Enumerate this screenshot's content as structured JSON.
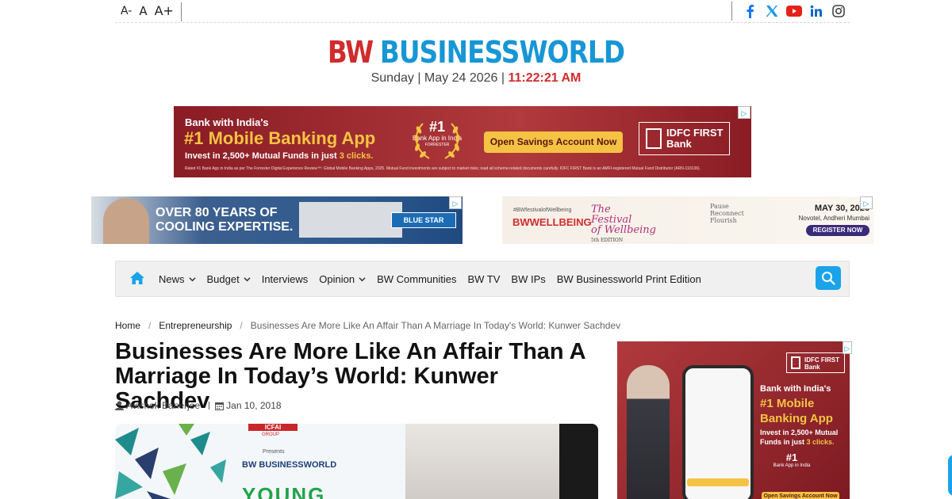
{
  "font_controls": {
    "decrease": "A-",
    "normal": "A",
    "increase": "A+"
  },
  "social_icons": [
    "facebook-icon",
    "x-icon",
    "youtube-icon",
    "linkedin-icon",
    "instagram-icon"
  ],
  "colors": {
    "brand_red": "#d12c2c",
    "brand_blue": "#1796d5",
    "search_button": "#1aa3e8",
    "ad_maroon": "#8a1c25",
    "ad_yellow": "#f5c343"
  },
  "logo": {
    "bw": "BW",
    "name": "BUSINESSWORLD"
  },
  "dateline": {
    "date": "Sunday | May 24 2026 |",
    "time": "11:22:21 AM"
  },
  "ads": {
    "top_banner": {
      "line1": "Bank with India's",
      "line2": "#1 Mobile Banking App",
      "line3_prefix": "Invest in 2,500+ Mutual Funds in just",
      "line3_highlight": "3 clicks.",
      "badge_number": "#1",
      "badge_text": "Bank App in India",
      "badge_source": "FORRESTER",
      "cta": "Open Savings Account Now",
      "bank_name_1": "IDFC FIRST",
      "bank_name_2": "Bank",
      "disclaimer": "Rated #1 Bank App in India as per The Forrester Digital Experience Review™: Global Mobile Banking Apps, 2025. Mutual Fund investments are subject to market risks; read all scheme-related documents carefully. IDFC FIRST Bank is an AMFI-registered Mutual Fund Distributor (ARN-110136)."
    },
    "left_banner": {
      "line1": "OVER 80 YEARS OF",
      "line2": "COOLING EXPERTISE.",
      "brand": "BLUE STAR"
    },
    "right_banner": {
      "hashtag": "#BWfestivalofWellbeing",
      "bw_wellbeing": "BWWELLBEING",
      "festival_1": "The",
      "festival_2": "Festival",
      "festival_3": "of Wellbeing",
      "edition": "5th EDITION",
      "tagline_1": "Pause",
      "tagline_2": "Reconnect",
      "tagline_3": "Flourish",
      "date": "MAY 30, 2026",
      "venue": "Novotel, Andheri Mumbai",
      "cta": "REGISTER NOW"
    },
    "side_banner": {
      "bank_name_1": "IDFC FIRST",
      "bank_name_2": "Bank",
      "line1": "Bank with India's",
      "line2": "#1 Mobile Banking App",
      "line3_prefix": "Invest in 2,500+ Mutual Funds in just",
      "line3_highlight": "3 clicks.",
      "badge_number": "#1",
      "badge_text": "Bank App in India",
      "cta": "Open Savings Account Now"
    }
  },
  "nav": {
    "items": [
      {
        "label": "News",
        "dropdown": true
      },
      {
        "label": "Budget",
        "dropdown": true
      },
      {
        "label": "Interviews",
        "dropdown": false
      },
      {
        "label": "Opinion",
        "dropdown": true
      },
      {
        "label": "BW Communities",
        "dropdown": false
      },
      {
        "label": "BW TV",
        "dropdown": false
      },
      {
        "label": "BW IPs",
        "dropdown": false
      },
      {
        "label": "BW Businessworld Print Edition",
        "dropdown": false
      }
    ]
  },
  "breadcrumb": {
    "home": "Home",
    "section": "Entrepreneurship",
    "current": "Businesses Are More Like An Affair Than A Marriage In Today's World: Kunwer Sachdev"
  },
  "article": {
    "title": "Businesses Are More Like An Affair Than A Marriage In Today’s World: Kunwer Sachdev",
    "author": "Avishek Banerjee",
    "date": "Jan 10, 2018",
    "hero": {
      "chip": "ICFAI",
      "group": "GROUP",
      "presents": "Presents",
      "logo": "BW BUSINESSWORLD",
      "headline": "YOUNG"
    }
  }
}
